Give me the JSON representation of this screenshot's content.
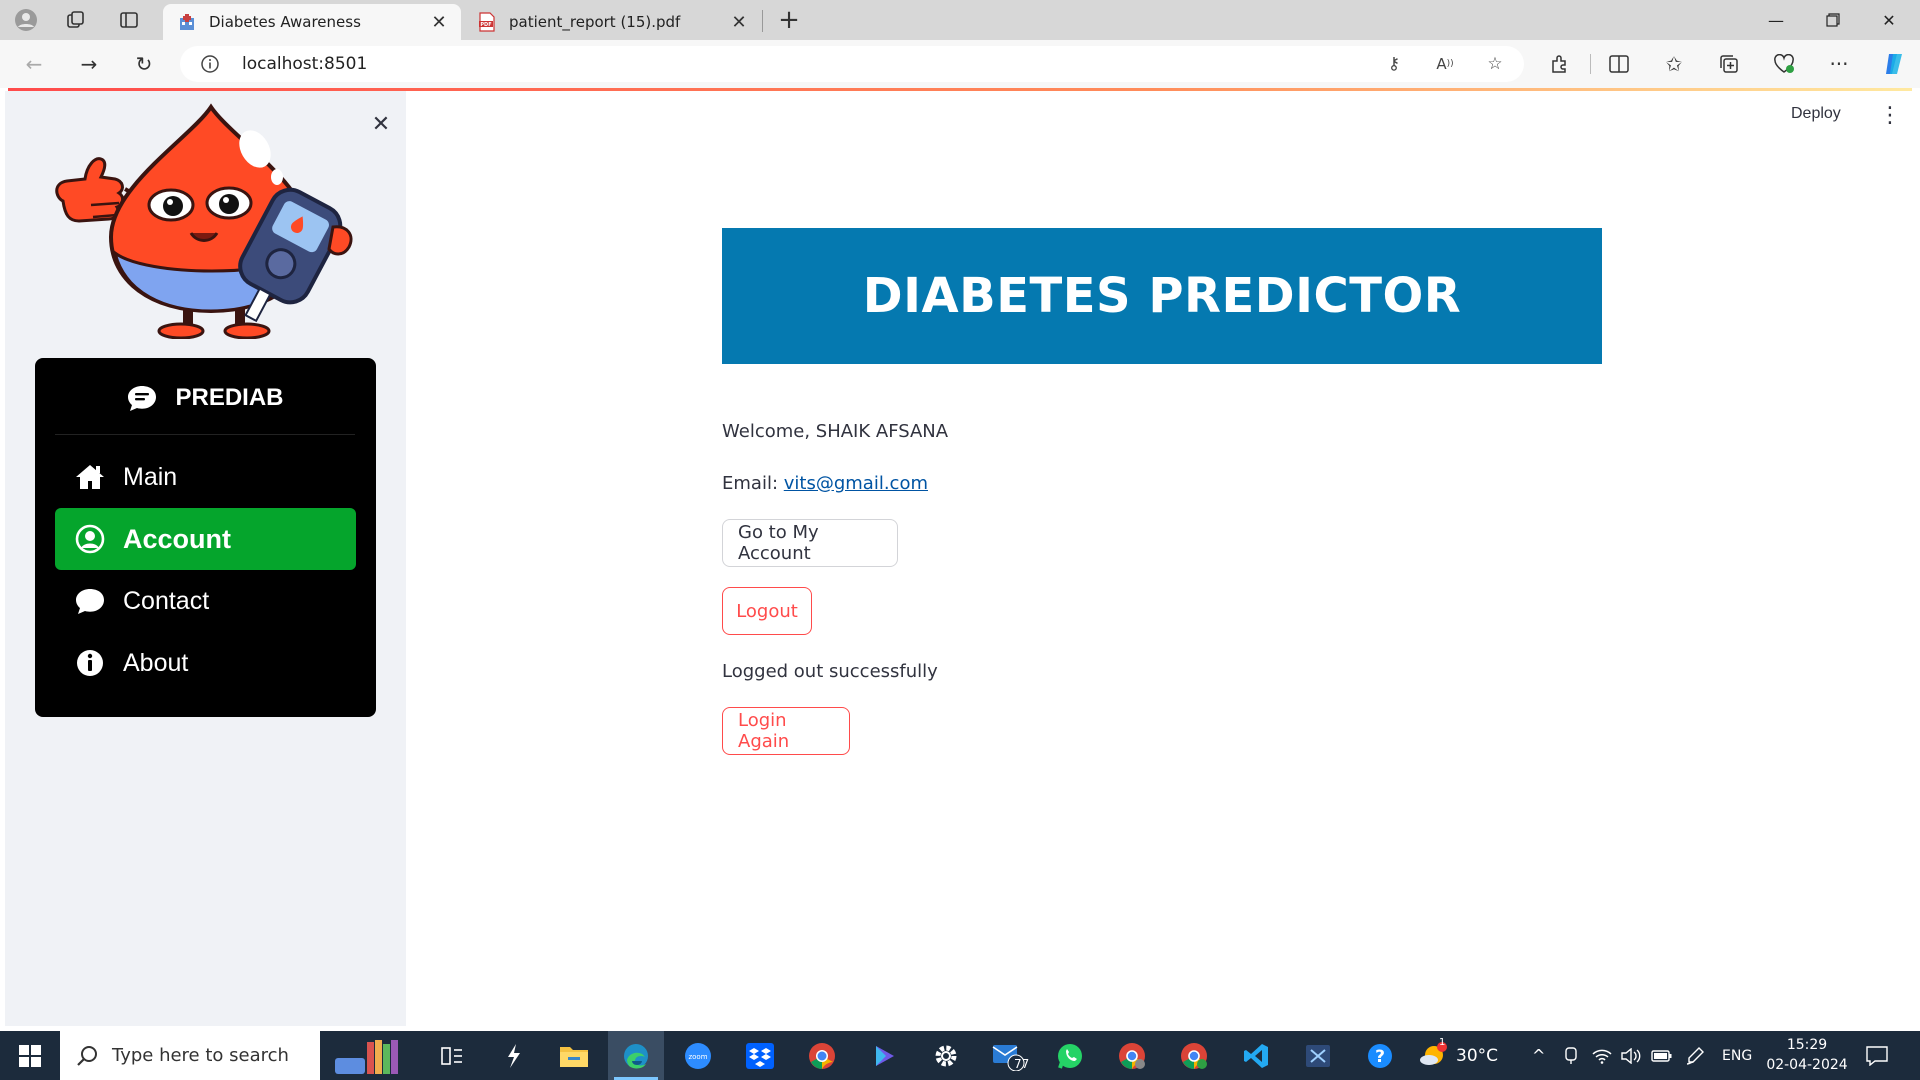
{
  "browser": {
    "tabs": [
      {
        "title": "Diabetes Awareness",
        "active": true
      },
      {
        "title": "patient_report (15).pdf",
        "active": false
      }
    ],
    "address": "localhost:8501"
  },
  "app": {
    "deploy_label": "Deploy",
    "sidebar": {
      "menu_title": "PREDIAB",
      "items": [
        {
          "label": "Main",
          "icon": "house-icon",
          "selected": false
        },
        {
          "label": "Account",
          "icon": "person-circle-icon",
          "selected": true
        },
        {
          "label": "Contact",
          "icon": "chat-icon",
          "selected": false
        },
        {
          "label": "About",
          "icon": "info-icon",
          "selected": false
        }
      ]
    },
    "main": {
      "banner_title": "DIABETES PREDICTOR",
      "welcome_text": "Welcome, SHAIK AFSANA",
      "email_label": "Email:",
      "email_value": "vits@gmail.com",
      "go_account_button": "Go to My Account",
      "logout_button": "Logout",
      "status_message": "Logged out successfully",
      "login_again_button": "Login Again"
    }
  },
  "taskbar": {
    "search_placeholder": "Type here to search",
    "mail_badge": "77",
    "weather_badge": "1",
    "temperature": "30°C",
    "language": "ENG",
    "time": "15:29",
    "date": "02-04-2024"
  },
  "colors": {
    "banner": "#0579b0",
    "selected_menu": "#05a52c",
    "menu_bg": "#000000",
    "sidebar_bg": "#f0f2f6",
    "button_red": "#ff4b4b",
    "link": "#0054a3"
  }
}
